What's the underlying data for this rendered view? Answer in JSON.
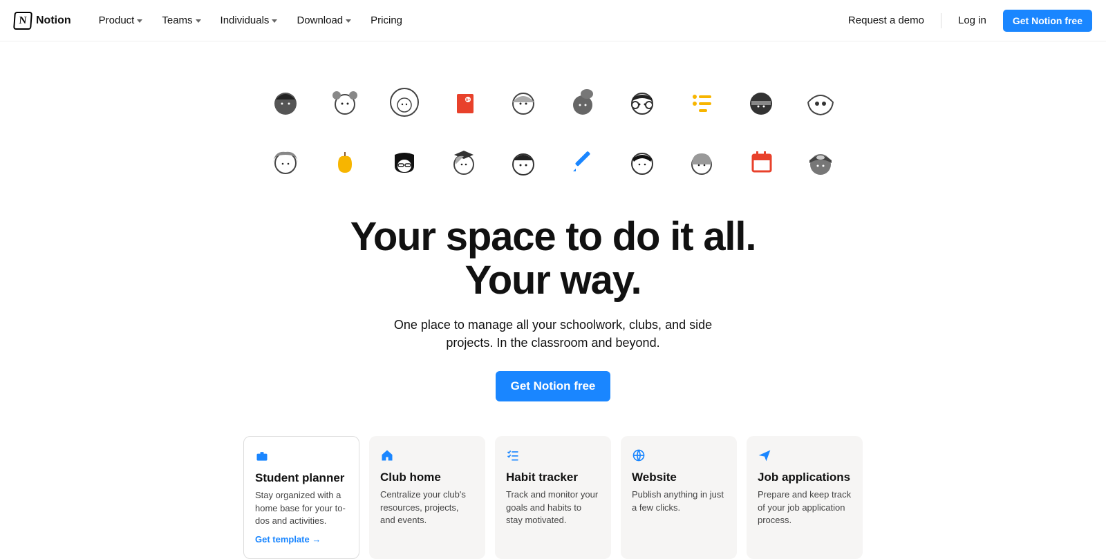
{
  "brand": "Notion",
  "nav": [
    "Product",
    "Teams",
    "Individuals",
    "Download",
    "Pricing"
  ],
  "nav_has_chevron": [
    true,
    true,
    true,
    true,
    false
  ],
  "header_right": {
    "demo": "Request a demo",
    "login": "Log in",
    "cta": "Get Notion free"
  },
  "hero": {
    "headline": "Your space to do it all. Your way.",
    "subhead": "One place to manage all your schoolwork, clubs, and side projects. In the classroom and beyond.",
    "cta": "Get Notion free"
  },
  "avatar_icons": [
    "face-1",
    "face-2",
    "face-3",
    "notebook",
    "face-4",
    "face-5",
    "face-6",
    "bullet-list",
    "face-7",
    "face-8",
    "face-9",
    "apple",
    "face-10",
    "grad",
    "face-11",
    "pencil",
    "face-12",
    "face-13",
    "calendar",
    "face-14"
  ],
  "cards": [
    {
      "icon": "briefcase",
      "title": "Student planner",
      "desc": "Stay organized with a home base for your to-dos and activities.",
      "link": "Get template →"
    },
    {
      "icon": "home",
      "title": "Club home",
      "desc": "Centralize your club's resources, projects, and events."
    },
    {
      "icon": "checklist",
      "title": "Habit tracker",
      "desc": "Track and monitor your goals and habits to stay motivated."
    },
    {
      "icon": "globe",
      "title": "Website",
      "desc": "Publish anything in just a few clicks."
    },
    {
      "icon": "send",
      "title": "Job applications",
      "desc": "Prepare and keep track of your job application process."
    }
  ]
}
